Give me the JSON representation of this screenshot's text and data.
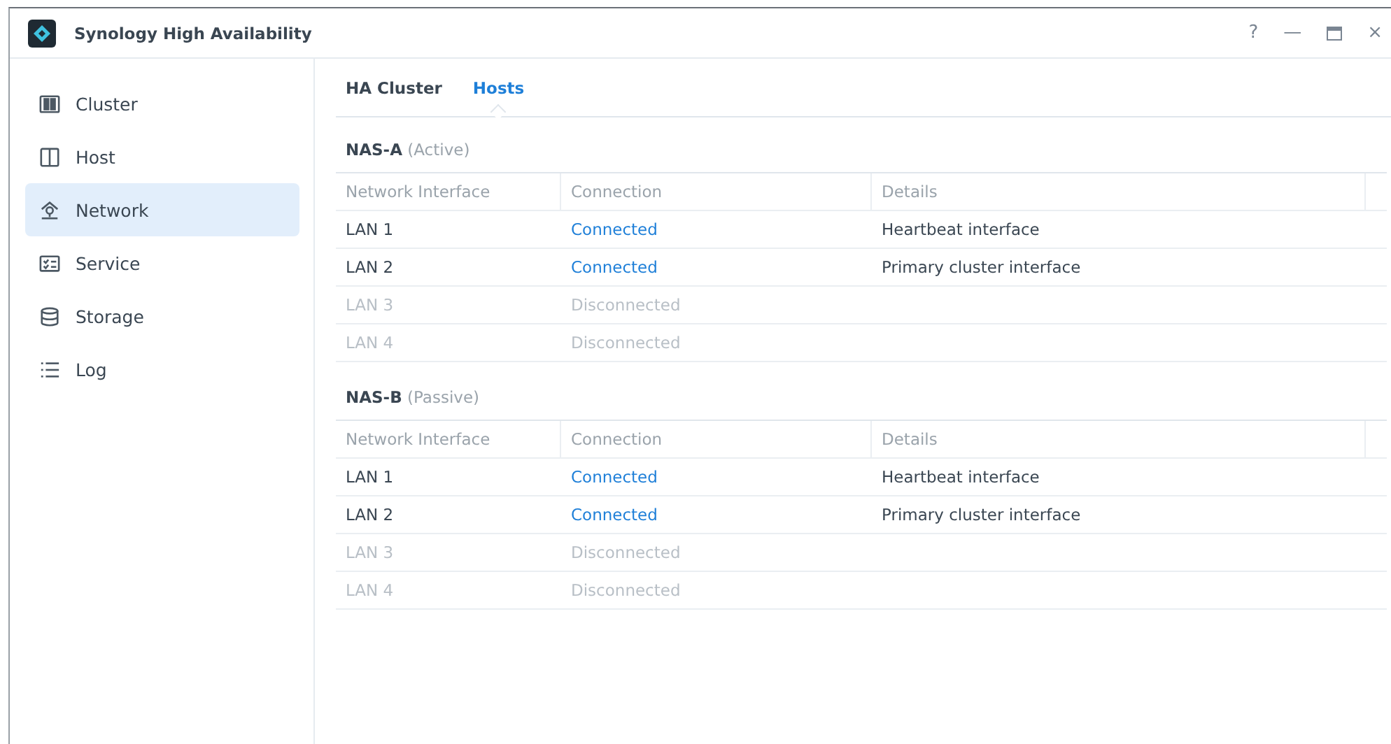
{
  "window": {
    "title": "Synology High Availability",
    "controls": [
      "?",
      "—",
      "×"
    ]
  },
  "sidebar": {
    "items": [
      {
        "label": "Cluster",
        "selected": false
      },
      {
        "label": "Host",
        "selected": false
      },
      {
        "label": "Network",
        "selected": true
      },
      {
        "label": "Service",
        "selected": false
      },
      {
        "label": "Storage",
        "selected": false
      },
      {
        "label": "Log",
        "selected": false
      }
    ]
  },
  "tabs": [
    {
      "label": "HA Cluster",
      "selected": false
    },
    {
      "label": "Hosts",
      "selected": true
    }
  ],
  "hosts": [
    {
      "name": "NAS-A",
      "role": "(Active)",
      "columns": [
        "Network Interface",
        "Connection",
        "Details"
      ],
      "rows": [
        {
          "interface": "LAN 1",
          "connection": "Connected",
          "details": "Heartbeat interface",
          "disabled": false
        },
        {
          "interface": "LAN 2",
          "connection": "Connected",
          "details": "Primary cluster interface",
          "disabled": false
        },
        {
          "interface": "LAN 3",
          "connection": "Disconnected",
          "disabled": true
        },
        {
          "interface": "LAN 4",
          "connection": "Disconnected",
          "disabled": true
        }
      ]
    },
    {
      "name": "NAS-B",
      "role": "(Passive)",
      "columns": [
        "Network Interface",
        "Connection",
        "Details"
      ],
      "rows": [
        {
          "interface": "LAN 1",
          "connection": "Connected",
          "details": "Heartbeat interface",
          "disabled": false
        },
        {
          "interface": "LAN 2",
          "connection": "Connected",
          "details": "Primary cluster interface",
          "disabled": false
        },
        {
          "interface": "LAN 3",
          "connection": "Disconnected",
          "disabled": true
        },
        {
          "interface": "LAN 4",
          "connection": "Disconnected",
          "disabled": true
        }
      ]
    }
  ]
}
